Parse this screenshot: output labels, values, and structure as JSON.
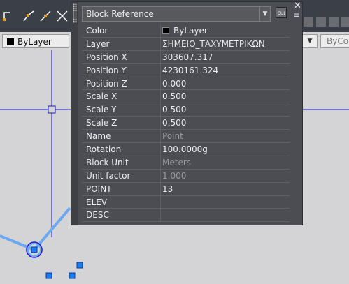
{
  "toolbar": {
    "layer_combo_value": "ByLayer",
    "bycolor_label": "ByCol"
  },
  "palette": {
    "selector_value": "Block Reference",
    "rows": [
      {
        "label": "Color",
        "value": "ByLayer"
      },
      {
        "label": "Layer",
        "value": "ΣΗΜΕΙΟ_ΤΑΧΥΜΕΤΡΙΚΩΝ"
      },
      {
        "label": "Position X",
        "value": "303607.317"
      },
      {
        "label": "Position Y",
        "value": "4230161.324"
      },
      {
        "label": "Position Z",
        "value": "0.000"
      },
      {
        "label": "Scale X",
        "value": "0.500"
      },
      {
        "label": "Scale Y",
        "value": "0.500"
      },
      {
        "label": "Scale Z",
        "value": "0.500"
      },
      {
        "label": "Name",
        "value": "Point"
      },
      {
        "label": "Rotation",
        "value": "100.0000g"
      },
      {
        "label": "Block Unit",
        "value": "Meters"
      },
      {
        "label": "Unit factor",
        "value": "1.000"
      },
      {
        "label": "POINT",
        "value": "13"
      },
      {
        "label": "ELEV",
        "value": ""
      },
      {
        "label": "DESC",
        "value": ""
      }
    ]
  }
}
